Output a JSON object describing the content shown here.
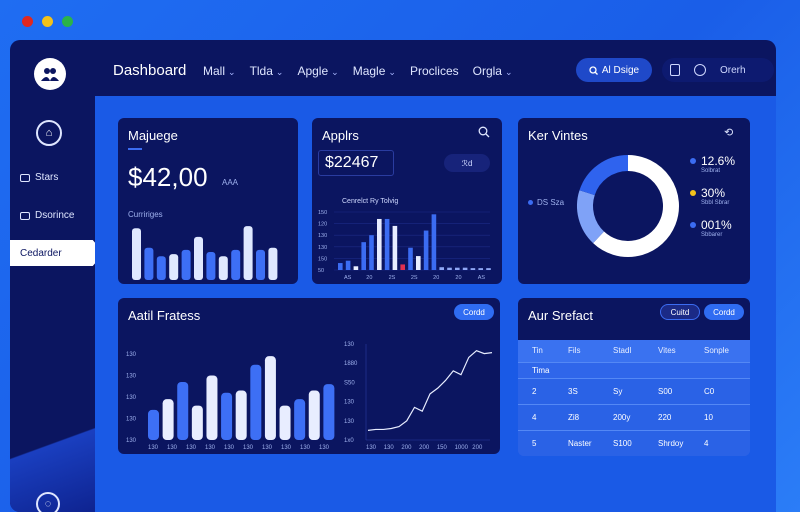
{
  "window_dots": [
    "#e0281f",
    "#f3c21b",
    "#2bb34a"
  ],
  "header": {
    "title": "Dashboard",
    "nav": [
      {
        "label": "Mall"
      },
      {
        "label": "Tlda"
      },
      {
        "label": "Apgle"
      },
      {
        "label": "Magle"
      },
      {
        "label": "Proclices",
        "no_chevron": true
      },
      {
        "label": "Orgla"
      }
    ],
    "action_button": "Al Dsige",
    "icon_labels": [
      "Orerh"
    ]
  },
  "sidebar": {
    "items": [
      {
        "label": "Stars"
      },
      {
        "label": "Dsorince"
      }
    ],
    "active_item": "Cedarder"
  },
  "card_revenue": {
    "title": "Majuege",
    "amount": "$42,00",
    "unit": "AAA",
    "chart_label": "Curririges",
    "chart_data": {
      "type": "bar",
      "values": [
        48,
        30,
        22,
        24,
        28,
        40,
        26,
        22,
        28,
        50,
        28,
        30
      ],
      "highlight": [
        0,
        3,
        5,
        7,
        9,
        11
      ],
      "colors": {
        "light": "#dfe8ff",
        "blue": "#3d6ff5"
      }
    }
  },
  "card_apps": {
    "title": "Applrs",
    "value": "$22467",
    "badge": "ℛd",
    "subtitle": "Cenrelct Ry Tolvig",
    "y_ticks": [
      "150",
      "120",
      "130",
      "130",
      "150",
      "50"
    ],
    "x_ticks": [
      "AS",
      "20",
      "2S",
      "2S",
      "20",
      "20",
      "AS"
    ],
    "chart_data": {
      "type": "bar",
      "values": [
        15,
        20,
        8,
        60,
        75,
        110,
        110,
        95,
        12,
        48,
        30,
        85,
        120,
        6,
        5,
        5,
        5,
        4,
        4,
        4
      ],
      "colors": [
        "#3b6cf2",
        "#3b6cf2",
        "#e8edff",
        "#3b6cf2",
        "#3b6cf2",
        "#e8edff",
        "#3b6cf2",
        "#e8edff",
        "#e03050",
        "#3b6cf2",
        "#e8edff",
        "#3b6cf2",
        "#3b6cf2",
        "#8fa7f5",
        "#8fa7f5",
        "#8fa7f5",
        "#8fa7f5",
        "#8fa7f5",
        "#8fa7f5",
        "#8fa7f5"
      ]
    }
  },
  "card_visits": {
    "title": "Ker Vintes",
    "left_label": "DS Sza",
    "legend": [
      {
        "value": "12.6%",
        "sub": "Solbrat",
        "color": "#3b6cf2"
      },
      {
        "value": "30%",
        "sub": "Sbbl Sbrar",
        "color": "#f3c21b"
      },
      {
        "value": "001%",
        "sub": "Sbbarer",
        "color": "#3b6cf2"
      }
    ],
    "chart_data": {
      "type": "pie",
      "values": [
        62,
        18,
        20
      ],
      "colors": [
        "#ffffff",
        "#7fa2f7",
        "#2f63ee"
      ]
    }
  },
  "card_activity": {
    "title": "Aatil Fratess",
    "button": "Cordd",
    "bar_y_ticks": [
      "130",
      "130",
      "130",
      "130",
      "130"
    ],
    "bar_x_ticks": [
      "130",
      "130",
      "130",
      "130",
      "130",
      "130",
      "130",
      "130",
      "130",
      "130"
    ],
    "line_y_ticks": [
      "130",
      "1880",
      "S50",
      "130",
      "130",
      "1x0"
    ],
    "line_x_ticks": [
      "130",
      "130",
      "200",
      "200",
      "150",
      "1000",
      "200"
    ],
    "bar_chart": {
      "type": "bar",
      "values": [
        28,
        38,
        54,
        32,
        60,
        44,
        46,
        70,
        78,
        32,
        38,
        46,
        52
      ],
      "colors": [
        "#3d6ff5",
        "#e8edff",
        "#3d6ff5",
        "#e8edff",
        "#e8edff",
        "#3d6ff5",
        "#e8edff",
        "#3d6ff5",
        "#e8edff",
        "#e8edff",
        "#3d6ff5",
        "#e8edff",
        "#3d6ff5"
      ]
    },
    "line_chart": {
      "type": "line",
      "values": [
        10,
        11,
        11,
        12,
        14,
        20,
        34,
        30,
        48,
        54,
        62,
        72,
        68,
        86,
        93,
        90,
        91
      ]
    }
  },
  "card_table": {
    "title": "Aur Srefact",
    "buttons": [
      "Cuitd",
      "Cordd"
    ],
    "columns": [
      "Tin",
      "Fils",
      "Stadl",
      "Vites",
      "Sonple"
    ],
    "rows": [
      [
        "Tima",
        "",
        "",
        "",
        ""
      ],
      [
        "2",
        "3S",
        "Sy",
        "S00",
        "C0"
      ],
      [
        "4",
        "Zi8",
        "200y",
        "220",
        "10"
      ],
      [
        "5",
        "Naster",
        "S100",
        "Shrdoy",
        "4"
      ]
    ]
  }
}
